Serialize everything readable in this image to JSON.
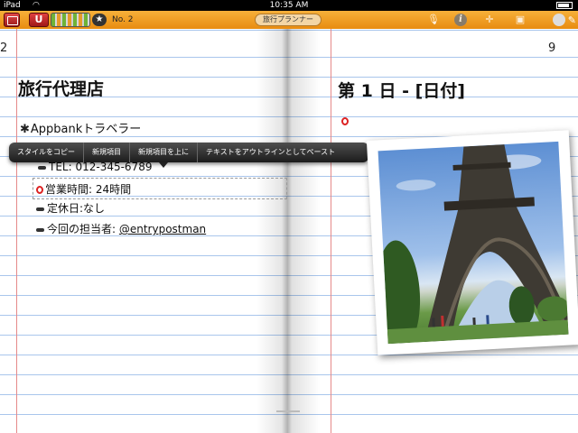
{
  "status_bar": {
    "carrier": "iPad",
    "time": "10:35 AM"
  },
  "toolbar": {
    "page_badge": "★",
    "page_number": "No. 2",
    "notebook_title": "旅行プランナー",
    "magnet_label": "U"
  },
  "left_page": {
    "page_number": "2",
    "heading": "旅行代理店",
    "items": {
      "company": "Appbankトラベラー",
      "tel": "TEL: 012-345-6789",
      "hours": "営業時間: 24時間",
      "holiday": "定休日:なし",
      "person_prefix": "今回の担当者: ",
      "person_handle": "@entrypostman"
    }
  },
  "right_page": {
    "page_number": "9",
    "heading": "第 1 日 - [日付]"
  },
  "context_menu": {
    "items": [
      "スタイルをコピー",
      "新規項目",
      "新規項目を上に",
      "テキストをアウトラインとしてペースト"
    ]
  },
  "icons": {
    "notebooks": "book-icon",
    "mic": "microphone-icon",
    "info": "info-icon",
    "pin": "pin-icon",
    "image": "image-icon"
  }
}
